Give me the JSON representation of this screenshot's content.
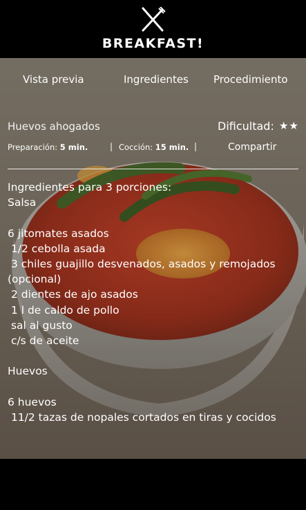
{
  "app": {
    "title": "BREAKFAST!",
    "logo_icon": "fork-knife-icon"
  },
  "tabs": [
    {
      "label": "Vista previa"
    },
    {
      "label": "Ingredientes"
    },
    {
      "label": "Procedimiento"
    }
  ],
  "recipe": {
    "name": "Huevos ahogados",
    "difficulty_label": "Dificultad:",
    "difficulty_stars": "★★",
    "prep_label": "Preparación:",
    "prep_value": "5 min.",
    "cook_label": "Cocción:",
    "cook_value": "15 min.",
    "share_label": "Compartir"
  },
  "ingredients": [
    "Ingredientes para 3 porciones:",
    "Salsa",
    "",
    "6 jitomates asados",
    " 1/2 cebolla asada",
    " 3 chiles guajillo desvenados, asados y remojados (opcional)",
    " 2 dientes de ajo asados",
    " 1 l de caldo de pollo",
    " sal al gusto",
    " c/s de aceite",
    "",
    "Huevos",
    "",
    "6 huevos",
    " 11/2 tazas de nopales cortados en tiras y cocidos"
  ]
}
